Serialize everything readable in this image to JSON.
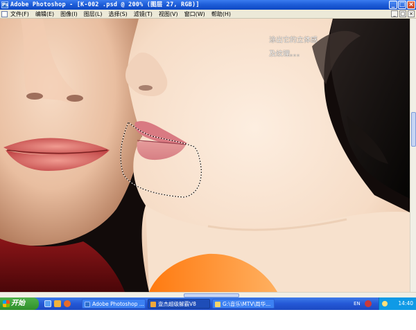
{
  "window": {
    "title": "Adobe Photoshop - [K-002 .psd @ 200% (图层 27, RGB)]",
    "app_icon_letter": "Ps",
    "minimize_label": "_",
    "maximize_label": "□",
    "close_label": "×"
  },
  "menubar": {
    "items": [
      "文件(F)",
      "编辑(E)",
      "图像(I)",
      "图层(L)",
      "选择(S)",
      "滤镜(T)",
      "视图(V)",
      "窗口(W)",
      "帮助(H)"
    ],
    "doc_minimize": "_",
    "doc_restore": "□",
    "doc_close": "×"
  },
  "canvas": {
    "annotation_line1": "涂出它的立体感",
    "annotation_line2": "及纹理。。。"
  },
  "taskbar": {
    "start_label": "开始",
    "tasks": [
      {
        "label": "Adobe Photoshop ..."
      },
      {
        "label": "壹杰超级解霸V8"
      },
      {
        "label": "G:\\音乐\\MTV\\周华..."
      }
    ],
    "language_indicator": "EN",
    "clock": "14:40"
  },
  "colors": {
    "titlebar": "#1f5fd9",
    "menubar": "#ece9d8",
    "taskbar": "#2458d6",
    "start": "#2f8f2b"
  }
}
